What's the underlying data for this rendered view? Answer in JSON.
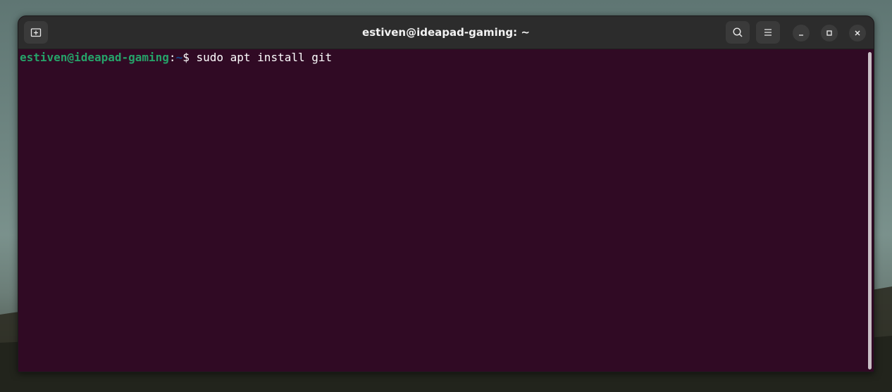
{
  "window": {
    "title": "estiven@ideapad-gaming: ~"
  },
  "header_buttons": {
    "new_tab_icon": "new-tab-icon",
    "search_icon": "search-icon",
    "menu_icon": "hamburger-menu-icon"
  },
  "window_controls": {
    "minimize_icon": "minimize-icon",
    "maximize_icon": "maximize-icon",
    "close_icon": "close-icon"
  },
  "terminal": {
    "user_host": "estiven@ideapad-gaming",
    "colon": ":",
    "path": "~",
    "dollar": "$",
    "command": " sudo apt install git"
  },
  "colors": {
    "terminal_bg": "#300a24",
    "prompt_user": "#26a269",
    "prompt_path": "#12488b",
    "titlebar_bg": "#2c2c2c"
  }
}
